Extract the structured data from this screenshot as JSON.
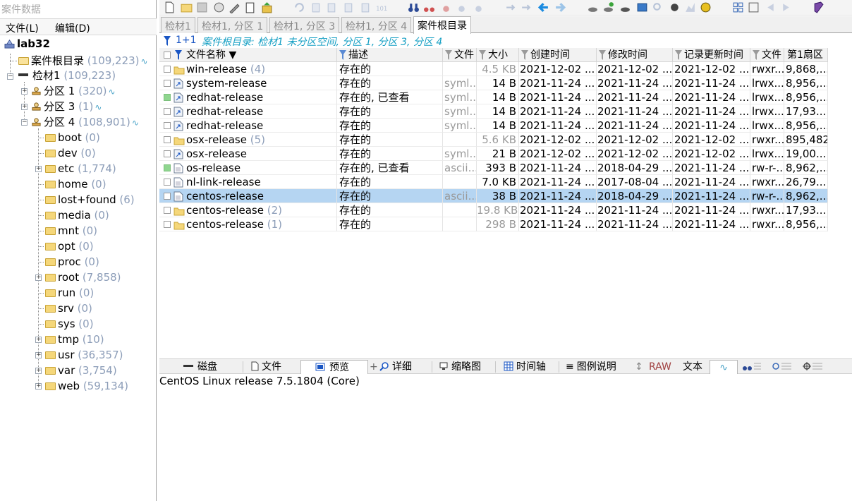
{
  "left_pane": {
    "title": "案件数据",
    "menu": {
      "file": "文件(L)",
      "edit": "编辑(D)"
    },
    "tree": {
      "root": {
        "label": "lab32"
      },
      "case_root": {
        "label": "案件根目录",
        "count": "(109,223)"
      },
      "evidence": {
        "label": "检材1",
        "count": "(109,223)"
      },
      "partitions": [
        {
          "label": "分区 1",
          "count": "(320)"
        },
        {
          "label": "分区 3",
          "count": "(1)"
        },
        {
          "label": "分区 4",
          "count": "(108,901)"
        }
      ],
      "folders": [
        {
          "label": "boot",
          "count": "(0)",
          "expandable": false
        },
        {
          "label": "dev",
          "count": "(0)",
          "expandable": false
        },
        {
          "label": "etc",
          "count": "(1,774)",
          "expandable": true
        },
        {
          "label": "home",
          "count": "(0)",
          "expandable": false
        },
        {
          "label": "lost+found",
          "count": "(6)",
          "expandable": false
        },
        {
          "label": "media",
          "count": "(0)",
          "expandable": false
        },
        {
          "label": "mnt",
          "count": "(0)",
          "expandable": false
        },
        {
          "label": "opt",
          "count": "(0)",
          "expandable": false
        },
        {
          "label": "proc",
          "count": "(0)",
          "expandable": false
        },
        {
          "label": "root",
          "count": "(7,858)",
          "expandable": true
        },
        {
          "label": "run",
          "count": "(0)",
          "expandable": false
        },
        {
          "label": "srv",
          "count": "(0)",
          "expandable": false
        },
        {
          "label": "sys",
          "count": "(0)",
          "expandable": false
        },
        {
          "label": "tmp",
          "count": "(10)",
          "expandable": true
        },
        {
          "label": "usr",
          "count": "(36,357)",
          "expandable": true
        },
        {
          "label": "var",
          "count": "(3,754)",
          "expandable": true
        },
        {
          "label": "web",
          "count": "(59,134)",
          "expandable": true
        }
      ]
    }
  },
  "tabs": [
    {
      "label": "检材1",
      "active": false
    },
    {
      "label": "检材1, 分区 1",
      "active": false
    },
    {
      "label": "检材1, 分区 3",
      "active": false
    },
    {
      "label": "检材1, 分区 4",
      "active": false
    },
    {
      "label": "案件根目录",
      "active": true
    }
  ],
  "filter_bar": {
    "count": "1+1",
    "description": "案件根目录: 检材1 未分区空间, 分区 1, 分区 3, 分区 4"
  },
  "table": {
    "headers": {
      "name": "文件名称",
      "desc": "描述",
      "type": "文件",
      "size": "大小",
      "created": "创建时间",
      "modified": "修改时间",
      "record_updated": "记录更新时间",
      "attr": "文件",
      "first_sector": "第1扇区"
    },
    "rows": [
      {
        "name": "win-release",
        "count": "(4)",
        "icon": "folder",
        "seen": false,
        "desc": "存在的",
        "type": "",
        "size": "4.5 KB",
        "size_gray": true,
        "created": "2021-12-02  ...",
        "modified": "2021-12-02  ...",
        "record_updated": "2021-12-02  ...",
        "attr": "rwxr...",
        "first_sector": "9,868,...",
        "selected": false
      },
      {
        "name": "system-release",
        "count": "",
        "icon": "symlink",
        "seen": false,
        "desc": "存在的",
        "type": "syml...",
        "size": "14 B",
        "size_gray": false,
        "created": "2021-11-24  ...",
        "modified": "2021-11-24  ...",
        "record_updated": "2021-11-24  ...",
        "attr": "lrwx...",
        "first_sector": "8,956,...",
        "selected": false
      },
      {
        "name": "redhat-release",
        "count": "",
        "icon": "symlink",
        "seen": true,
        "desc": "存在的, 已查看",
        "type": "syml...",
        "size": "14 B",
        "size_gray": false,
        "created": "2021-11-24  ...",
        "modified": "2021-11-24  ...",
        "record_updated": "2021-11-24  ...",
        "attr": "lrwx...",
        "first_sector": "8,956,...",
        "selected": false
      },
      {
        "name": "redhat-release",
        "count": "",
        "icon": "symlink",
        "seen": false,
        "desc": "存在的",
        "type": "syml...",
        "size": "14 B",
        "size_gray": false,
        "created": "2021-11-24  ...",
        "modified": "2021-11-24  ...",
        "record_updated": "2021-11-24  ...",
        "attr": "lrwx...",
        "first_sector": "17,93...",
        "selected": false
      },
      {
        "name": "redhat-release",
        "count": "",
        "icon": "symlink",
        "seen": false,
        "desc": "存在的",
        "type": "syml...",
        "size": "14 B",
        "size_gray": false,
        "created": "2021-11-24  ...",
        "modified": "2021-11-24  ...",
        "record_updated": "2021-11-24  ...",
        "attr": "lrwx...",
        "first_sector": "8,956,...",
        "selected": false
      },
      {
        "name": "osx-release",
        "count": "(5)",
        "icon": "folder",
        "seen": false,
        "desc": "存在的",
        "type": "",
        "size": "5.6 KB",
        "size_gray": true,
        "created": "2021-12-02  ...",
        "modified": "2021-12-02  ...",
        "record_updated": "2021-12-02  ...",
        "attr": "rwxr...",
        "first_sector": "895,482",
        "selected": false
      },
      {
        "name": "osx-release",
        "count": "",
        "icon": "symlink",
        "seen": false,
        "desc": "存在的",
        "type": "syml...",
        "size": "21 B",
        "size_gray": false,
        "created": "2021-12-02  ...",
        "modified": "2021-12-02  ...",
        "record_updated": "2021-12-02  ...",
        "attr": "lrwx...",
        "first_sector": "19,00...",
        "selected": false
      },
      {
        "name": "os-release",
        "count": "",
        "icon": "file",
        "seen": true,
        "desc": "存在的, 已查看",
        "type": "ascii...",
        "size": "393 B",
        "size_gray": false,
        "created": "2021-11-24  ...",
        "modified": "2018-04-29  ...",
        "record_updated": "2021-11-24  ...",
        "attr": "rw-r-...",
        "first_sector": "8,962,...",
        "selected": false
      },
      {
        "name": "nl-link-release",
        "count": "",
        "icon": "file",
        "seen": false,
        "desc": "存在的",
        "type": "",
        "size": "7.0 KB",
        "size_gray": false,
        "created": "2021-11-24  ...",
        "modified": "2017-08-04  ...",
        "record_updated": "2021-11-24  ...",
        "attr": "rwxr...",
        "first_sector": "26,79...",
        "selected": false
      },
      {
        "name": "centos-release",
        "count": "",
        "icon": "file",
        "seen": false,
        "desc": "存在的",
        "type": "ascii...",
        "size": "38 B",
        "size_gray": false,
        "created": "2021-11-24  ...",
        "modified": "2018-04-29  ...",
        "record_updated": "2021-11-24  ...",
        "attr": "rw-r-...",
        "first_sector": "8,962,...",
        "selected": true
      },
      {
        "name": "centos-release",
        "count": "(2)",
        "icon": "folder",
        "seen": false,
        "desc": "存在的",
        "type": "",
        "size": "19.8 KB",
        "size_gray": true,
        "created": "2021-11-24  ...",
        "modified": "2021-11-24  ...",
        "record_updated": "2021-11-24  ...",
        "attr": "rwxr...",
        "first_sector": "17,93...",
        "selected": false
      },
      {
        "name": "centos-release",
        "count": "(1)",
        "icon": "folder",
        "seen": false,
        "desc": "存在的",
        "type": "",
        "size": "298 B",
        "size_gray": true,
        "created": "2021-11-24  ...",
        "modified": "2021-11-24  ...",
        "record_updated": "2021-11-24  ...",
        "attr": "rwxr...",
        "first_sector": "8,956,...",
        "selected": false
      }
    ]
  },
  "view_tabs": [
    {
      "label": "磁盘",
      "icon": "disk-icon",
      "active": false
    },
    {
      "label": "文件",
      "icon": "file-icon",
      "active": false
    },
    {
      "label": "预览",
      "icon": "preview-icon",
      "active": true
    },
    {
      "label": "详细",
      "icon": "details-icon",
      "active": false
    },
    {
      "label": "缩略图",
      "icon": "thumbnail-icon",
      "active": false
    },
    {
      "label": "时间轴",
      "icon": "timeline-icon",
      "active": false
    },
    {
      "label": "图例说明",
      "icon": "legend-icon",
      "active": false
    },
    {
      "label": "RAW",
      "icon": "",
      "active": false
    },
    {
      "label": "文本",
      "icon": "",
      "active": false
    }
  ],
  "preview": {
    "text": "CentOS Linux release 7.5.1804 (Core)"
  },
  "colors": {
    "selection": "#b5d5f2",
    "count": "#8c9db8",
    "filter_desc": "#17a0c4",
    "seen": "#8fd68f"
  }
}
